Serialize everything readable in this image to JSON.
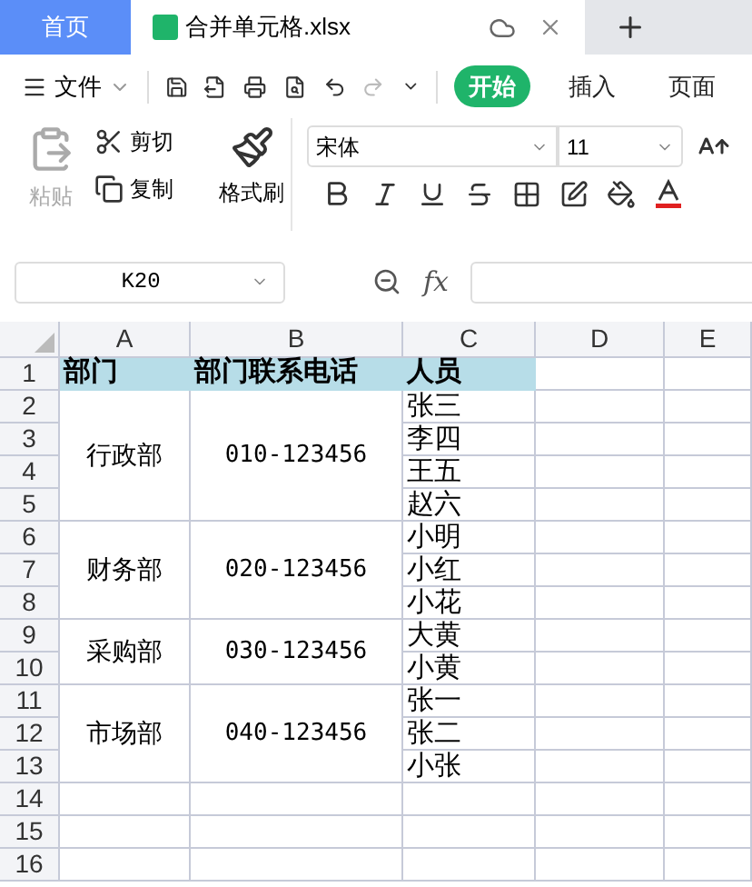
{
  "tabs": [
    {
      "label": "首页",
      "kind": "home",
      "selected": false
    },
    {
      "label": "合并单元格.xlsx",
      "kind": "file",
      "selected": true
    }
  ],
  "menu": {
    "file_label": "文件",
    "redo_disabled": true,
    "ribbon_tabs": [
      {
        "label": "开始",
        "selected": true
      },
      {
        "label": "插入",
        "selected": false
      },
      {
        "label": "页面",
        "selected": false
      }
    ]
  },
  "ribbon": {
    "paste": {
      "label": "粘贴",
      "disabled": true
    },
    "cut": "剪切",
    "copy": "复制",
    "format_painter": "格式刷",
    "font": "宋体",
    "size": "11"
  },
  "formula_bar": {
    "cell": "K20",
    "fx": "fx"
  },
  "sheet": {
    "columns": [
      "A",
      "B",
      "C",
      "D",
      "E"
    ],
    "row_numbers": [
      "1",
      "2",
      "3",
      "4",
      "5",
      "6",
      "7",
      "8",
      "9",
      "10",
      "11",
      "12",
      "13",
      "14",
      "15",
      "16"
    ],
    "header": [
      "部门",
      "部门联系电话",
      "人员"
    ],
    "groups": [
      {
        "dept": "行政部",
        "phone": "010-123456",
        "people": [
          "张三",
          "李四",
          "王五",
          "赵六"
        ]
      },
      {
        "dept": "财务部",
        "phone": "020-123456",
        "people": [
          "小明",
          "小红",
          "小花"
        ]
      },
      {
        "dept": "采购部",
        "phone": "030-123456",
        "people": [
          "大黄",
          "小黄"
        ]
      },
      {
        "dept": "市场部",
        "phone": "040-123456",
        "people": [
          "张一",
          "张二",
          "小张"
        ]
      }
    ]
  }
}
